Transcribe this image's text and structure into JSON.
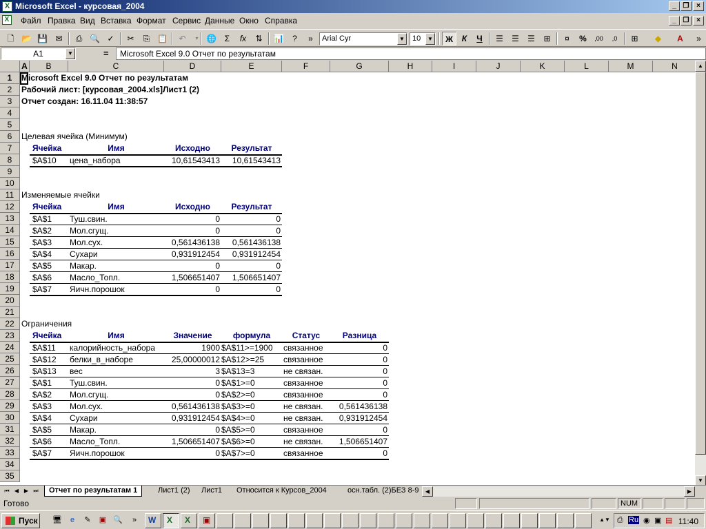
{
  "window": {
    "title": "Microsoft Excel - курсовая_2004"
  },
  "menu": [
    "Файл",
    "Правка",
    "Вид",
    "Вставка",
    "Формат",
    "Сервис",
    "Данные",
    "Окно",
    "Справка"
  ],
  "toolbar": {
    "font": "Arial Cyr",
    "size": "10",
    "bold": "Ж",
    "italic": "К",
    "underline": "Ч",
    "percent": "%",
    "sigma": "Σ",
    "fx": "fx"
  },
  "formula_bar": {
    "cell": "A1",
    "eq": "=",
    "content": "Microsoft Excel 9.0 Отчет по результатам"
  },
  "columns": [
    "A",
    "B",
    "C",
    "D",
    "E",
    "F",
    "G",
    "H",
    "I",
    "J",
    "K",
    "L",
    "M",
    "N"
  ],
  "rows": [
    "1",
    "2",
    "3",
    "4",
    "5",
    "6",
    "7",
    "8",
    "9",
    "10",
    "11",
    "12",
    "13",
    "14",
    "15",
    "16",
    "17",
    "18",
    "19",
    "20",
    "21",
    "22",
    "23",
    "24",
    "25",
    "26",
    "27",
    "28",
    "29",
    "30",
    "31",
    "32",
    "33",
    "34",
    "35"
  ],
  "report": {
    "line1": "Microsoft Excel 9.0 Отчет по результатам",
    "line2": "Рабочий лист: [курсовая_2004.xls]Лист1 (2)",
    "line3": "Отчет создан: 16.11.04 11:38:57",
    "target_title": "Целевая ячейка (Минимум)",
    "target_headers": [
      "Ячейка",
      "Имя",
      "Исходно",
      "Результат"
    ],
    "target_rows": [
      [
        "$A$10",
        "цена_набора",
        "10,61543413",
        "10,61543413"
      ]
    ],
    "changing_title": "Изменяемые ячейки",
    "changing_headers": [
      "Ячейка",
      "Имя",
      "Исходно",
      "Результат"
    ],
    "changing_rows": [
      [
        "$A$1",
        "Туш.свин.",
        "0",
        "0"
      ],
      [
        "$A$2",
        "Мол.сгущ.",
        "0",
        "0"
      ],
      [
        "$A$3",
        "Мол.сух.",
        "0,561436138",
        "0,561436138"
      ],
      [
        "$A$4",
        "Сухари",
        "0,931912454",
        "0,931912454"
      ],
      [
        "$A$5",
        "Макар.",
        "0",
        "0"
      ],
      [
        "$A$6",
        "Масло_Топл.",
        "1,506651407",
        "1,506651407"
      ],
      [
        "$A$7",
        "Яичн.порошок",
        "0",
        "0"
      ]
    ],
    "constraints_title": "Ограничения",
    "constraints_headers": [
      "Ячейка",
      "Имя",
      "Значение",
      "формула",
      "Статус",
      "Разница"
    ],
    "constraints_rows": [
      [
        "$A$11",
        "калорийность_набора",
        "1900",
        "$A$11>=1900",
        "связанное",
        "0"
      ],
      [
        "$A$12",
        "белки_в_наборе",
        "25,00000012",
        "$A$12>=25",
        "связанное",
        "0"
      ],
      [
        "$A$13",
        "вес",
        "3",
        "$A$13=3",
        "не связан.",
        "0"
      ],
      [
        "$A$1",
        "Туш.свин.",
        "0",
        "$A$1>=0",
        "связанное",
        "0"
      ],
      [
        "$A$2",
        "Мол.сгущ.",
        "0",
        "$A$2>=0",
        "связанное",
        "0"
      ],
      [
        "$A$3",
        "Мол.сух.",
        "0,561436138",
        "$A$3>=0",
        "не связан.",
        "0,561436138"
      ],
      [
        "$A$4",
        "Сухари",
        "0,931912454",
        "$A$4>=0",
        "не связан.",
        "0,931912454"
      ],
      [
        "$A$5",
        "Макар.",
        "0",
        "$A$5>=0",
        "связанное",
        "0"
      ],
      [
        "$A$6",
        "Масло_Топл.",
        "1,506651407",
        "$A$6>=0",
        "не связан.",
        "1,506651407"
      ],
      [
        "$A$7",
        "Яичн.порошок",
        "0",
        "$A$7>=0",
        "связанное",
        "0"
      ]
    ]
  },
  "sheet_tabs": [
    "Отчет по результатам 1",
    "Лист1 (2)",
    "Лист1",
    "Относится к Курсов_2004",
    "осн.табл. (2)БЕЗ 8-9"
  ],
  "status": {
    "text": "Готово",
    "num": "NUM"
  },
  "taskbar": {
    "start": "Пуск",
    "lang": "Ru",
    "clock": "11:40"
  }
}
